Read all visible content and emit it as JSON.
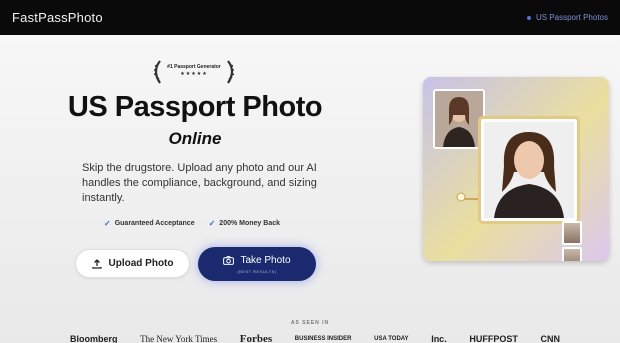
{
  "topbar": {
    "brand": "FastPassPhoto",
    "nav_link": "US Passport Photos"
  },
  "badge": {
    "text": "#1 Passport Generator",
    "stars": "★★★★★"
  },
  "hero": {
    "title": "US Passport Photo",
    "subtitle": "Online",
    "description": "Skip the drugstore. Upload any photo and our AI handles the compliance, background, and sizing instantly."
  },
  "perks": [
    "Guaranteed Acceptance",
    "200% Money Back"
  ],
  "buttons": {
    "upload": "Upload Photo",
    "take": "Take Photo",
    "take_sub": "(BEST RESULTS)"
  },
  "as_seen_in": {
    "label": "AS SEEN IN",
    "logos": [
      "Bloomberg",
      "The New York Times",
      "Forbes",
      "BUSINESS INSIDER",
      "USA TODAY",
      "Inc.",
      "HUFFPOST",
      "CNN"
    ]
  },
  "colors": {
    "topbar": "#0a0a0a",
    "accent": "#3f63c8",
    "primary_button": "#1b2a6e"
  }
}
